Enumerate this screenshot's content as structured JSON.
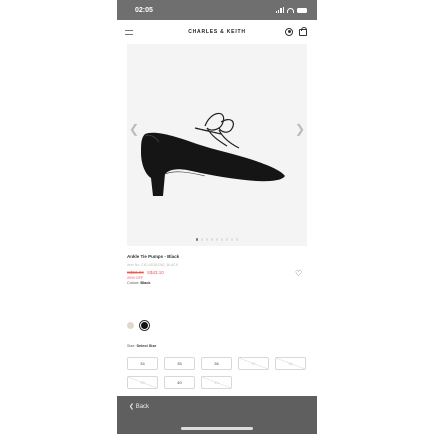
{
  "status_bar": {
    "time": "02:05"
  },
  "header": {
    "brand": "CHARLES & KEITH"
  },
  "gallery": {
    "image_count": 9,
    "active_index": 0
  },
  "product": {
    "name": "Ankle Tie Pumps - Black",
    "sku": "Item No. CK1-60361362_BLACK",
    "old_price": "S$53.90",
    "new_price": "S$43.10",
    "discount": "20% OFF"
  },
  "colour": {
    "label": "Colour:",
    "selected": "Black",
    "swatches": [
      "Chalk",
      "Black"
    ]
  },
  "size": {
    "label": "Size:",
    "prompt": "Select Size",
    "options": [
      {
        "label": "34",
        "available": true
      },
      {
        "label": "35",
        "available": true
      },
      {
        "label": "36",
        "available": true
      },
      {
        "label": "37",
        "available": false
      },
      {
        "label": "38",
        "available": false
      },
      {
        "label": "39",
        "available": false
      },
      {
        "label": "40",
        "available": true
      },
      {
        "label": "41",
        "available": false
      }
    ]
  },
  "bottom_bar": {
    "back_label": "Back"
  },
  "colors": {
    "status_bar_bg": "#6f6f6f",
    "sale_red": "#e55555",
    "bottom_bar_bg": "#5f5f5f"
  }
}
